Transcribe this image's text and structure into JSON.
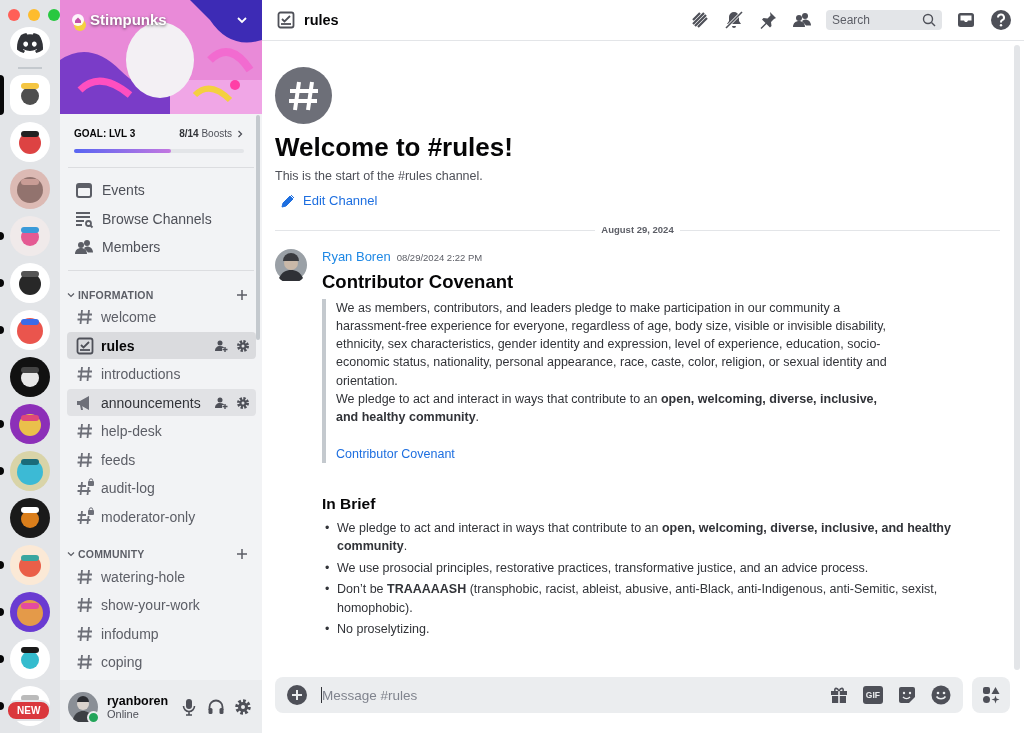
{
  "servers": [
    {
      "selected": true,
      "unread": false
    },
    {
      "selected": false,
      "unread": false
    },
    {
      "selected": false,
      "unread": false
    },
    {
      "selected": false,
      "unread": true
    },
    {
      "selected": false,
      "unread": true
    },
    {
      "selected": false,
      "unread": true
    },
    {
      "selected": false,
      "unread": false
    },
    {
      "selected": false,
      "unread": true
    },
    {
      "selected": false,
      "unread": true
    },
    {
      "selected": false,
      "unread": false
    },
    {
      "selected": false,
      "unread": true
    },
    {
      "selected": false,
      "unread": true
    },
    {
      "selected": false,
      "unread": true
    },
    {
      "selected": false,
      "unread": true
    }
  ],
  "new_badge": "NEW",
  "guild": {
    "name": "Stimpunks",
    "goal": "GOAL: LVL 3",
    "boosts_count": "8/14",
    "boosts_label": "Boosts",
    "level": 0.57
  },
  "nav": [
    {
      "label": "Events",
      "kind": "events"
    },
    {
      "label": "Browse Channels",
      "kind": "browse"
    },
    {
      "label": "Members",
      "kind": "members"
    }
  ],
  "categories": [
    {
      "name": "INFORMATION",
      "expanded": true,
      "channels": [
        {
          "name": "welcome",
          "kind": "text",
          "selected": false,
          "highlighted": false
        },
        {
          "name": "rules",
          "kind": "rules",
          "selected": true,
          "highlighted": true
        },
        {
          "name": "introductions",
          "kind": "text",
          "selected": false,
          "highlighted": false
        },
        {
          "name": "announcements",
          "kind": "announcement",
          "selected": false,
          "highlighted": true
        },
        {
          "name": "help-desk",
          "kind": "text",
          "selected": false,
          "highlighted": false
        },
        {
          "name": "feeds",
          "kind": "text",
          "selected": false,
          "highlighted": false
        },
        {
          "name": "audit-log",
          "kind": "locked",
          "selected": false,
          "highlighted": false
        },
        {
          "name": "moderator-only",
          "kind": "locked",
          "selected": false,
          "highlighted": false
        }
      ]
    },
    {
      "name": "COMMUNITY",
      "expanded": true,
      "channels": [
        {
          "name": "watering-hole",
          "kind": "text",
          "selected": false,
          "highlighted": false
        },
        {
          "name": "show-your-work",
          "kind": "text",
          "selected": false,
          "highlighted": false
        },
        {
          "name": "infodump",
          "kind": "text",
          "selected": false,
          "highlighted": false
        },
        {
          "name": "coping",
          "kind": "text",
          "selected": false,
          "highlighted": false
        }
      ]
    }
  ],
  "user": {
    "name": "ryanboren",
    "status": "Online"
  },
  "header": {
    "channel": "rules",
    "search_placeholder": "Search"
  },
  "intro": {
    "title": "Welcome to #rules!",
    "subtitle": "This is the start of the #rules channel.",
    "edit_link": "Edit Channel"
  },
  "divider_date": "August 29, 2024",
  "message": {
    "author": "Ryan Boren",
    "timestamp": "08/29/2024 2:22 PM",
    "heading": "Contributor Covenant",
    "quote": [
      "We as members, contributors, and leaders pledge to make participation in our community a harassment-free experience for everyone, regardless of age, body size, visible or invisible disability, ethnicity, sex characteristics, gender identity and expression, level of experience, education, socio-economic status, nationality, personal appearance, race, caste, color, religion, or sexual identity and orientation.",
      "We pledge to act and interact in ways that contribute to an **open, welcoming, diverse, inclusive, and healthy community**."
    ],
    "quote_link": "Contributor Covenant",
    "subheading": "In Brief",
    "bullets": [
      {
        "marker": "•",
        "text": "We pledge to act and interact in ways that contribute to an **open, welcoming, diverse, inclusive, and healthy community**."
      },
      {
        "marker": "•",
        "text": "We use prosocial principles, restorative practices, transformative justice, and an advice process."
      },
      {
        "marker": "•",
        "text": "Don’t be **TRAAAAASH** (transphobic, racist, ableist, abusive, anti-Black, anti-Indigenous, anti-Semitic, sexist, homophobic)."
      },
      {
        "marker": "•",
        "text": "No proselytizing."
      }
    ]
  },
  "composer": {
    "placeholder": "Message #rules",
    "gif_label": "GIF"
  }
}
